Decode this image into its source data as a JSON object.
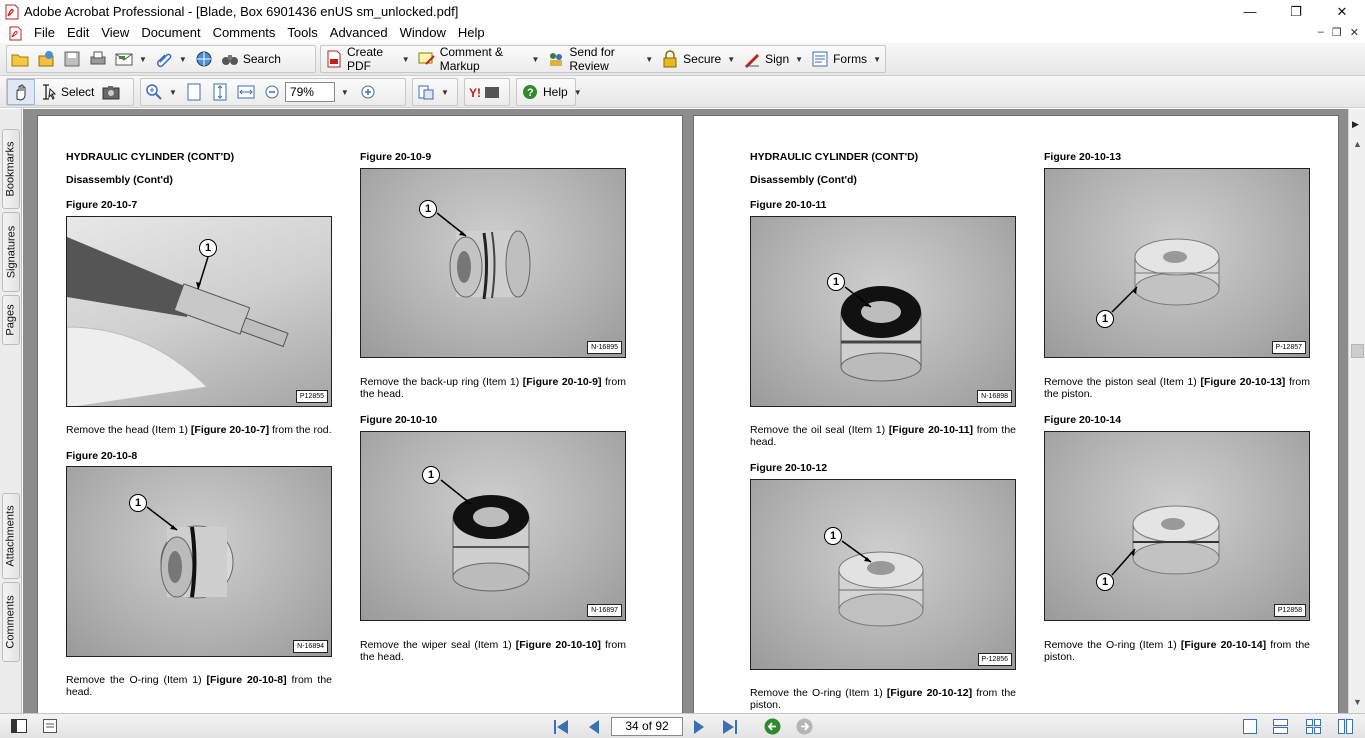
{
  "window": {
    "title": "Adobe Acrobat Professional - [Blade, Box 6901436 enUS sm_unlocked.pdf]",
    "min_glyph": "—",
    "max_glyph": "❐",
    "close_glyph": "✕"
  },
  "menu": {
    "items": [
      "File",
      "Edit",
      "View",
      "Document",
      "Comments",
      "Tools",
      "Advanced",
      "Window",
      "Help"
    ],
    "mdi_min": "–",
    "mdi_restore": "❐",
    "mdi_close": "✕"
  },
  "toolbar1": {
    "search_label": "Search",
    "create_pdf_label": "Create PDF",
    "comment_markup_label": "Comment & Markup",
    "send_review_label": "Send for Review",
    "secure_label": "Secure",
    "sign_label": "Sign",
    "forms_label": "Forms"
  },
  "toolbar2": {
    "select_label": "Select",
    "zoom_value": "79%",
    "help_label": "Help"
  },
  "side_tabs": [
    "Bookmarks",
    "Signatures",
    "Pages",
    "Attachments",
    "Comments"
  ],
  "page_left": {
    "heading": "HYDRAULIC CYLINDER (CONT'D)",
    "subheading": "Disassembly (Cont'd)",
    "figures": [
      {
        "label": "Figure 20-10-7",
        "code": "P12855",
        "callout": "1",
        "caption_pre": "Remove the head (Item 1) ",
        "caption_ref": "[Figure 20-10-7]",
        "caption_post": " from the rod."
      },
      {
        "label": "Figure 20-10-8",
        "code": "N-16894",
        "callout": "1",
        "caption_pre": "Remove the O-ring (Item 1) ",
        "caption_ref": "[Figure 20-10-8]",
        "caption_post": " from the head."
      },
      {
        "label": "Figure 20-10-9",
        "code": "N-16895",
        "callout": "1",
        "caption_pre": "Remove the back-up ring (Item 1) ",
        "caption_ref": "[Figure 20-10-9]",
        "caption_post": " from the head."
      },
      {
        "label": "Figure 20-10-10",
        "code": "N-16897",
        "callout": "1",
        "caption_pre": "Remove the wiper seal (Item 1) ",
        "caption_ref": "[Figure 20-10-10]",
        "caption_post": " from the head."
      }
    ]
  },
  "page_right": {
    "heading": "HYDRAULIC CYLINDER (CONT'D)",
    "subheading": "Disassembly (Cont'd)",
    "figures": [
      {
        "label": "Figure 20-10-11",
        "code": "N-16898",
        "callout": "1",
        "caption_pre": "Remove the oil seal (Item 1) ",
        "caption_ref": "[Figure 20-10-11]",
        "caption_post": " from the head."
      },
      {
        "label": "Figure 20-10-12",
        "code": "P-12856",
        "callout": "1",
        "caption_pre": "Remove the O-ring (Item 1) ",
        "caption_ref": "[Figure 20-10-12]",
        "caption_post": " from the piston."
      },
      {
        "label": "Figure 20-10-13",
        "code": "P-12857",
        "callout": "1",
        "caption_pre": "Remove the piston seal (Item 1) ",
        "caption_ref": "[Figure 20-10-13]",
        "caption_post": " from the piston."
      },
      {
        "label": "Figure 20-10-14",
        "code": "P12858",
        "callout": "1",
        "caption_pre": "Remove the O-ring (Item 1) ",
        "caption_ref": "[Figure 20-10-14]",
        "caption_post": " from the piston."
      }
    ]
  },
  "status": {
    "page_indicator": "34 of 92"
  },
  "colors": {
    "doc_background": "#8c8c8c",
    "toolbar": "#ececec",
    "acrobat_red": "#c0201a"
  }
}
